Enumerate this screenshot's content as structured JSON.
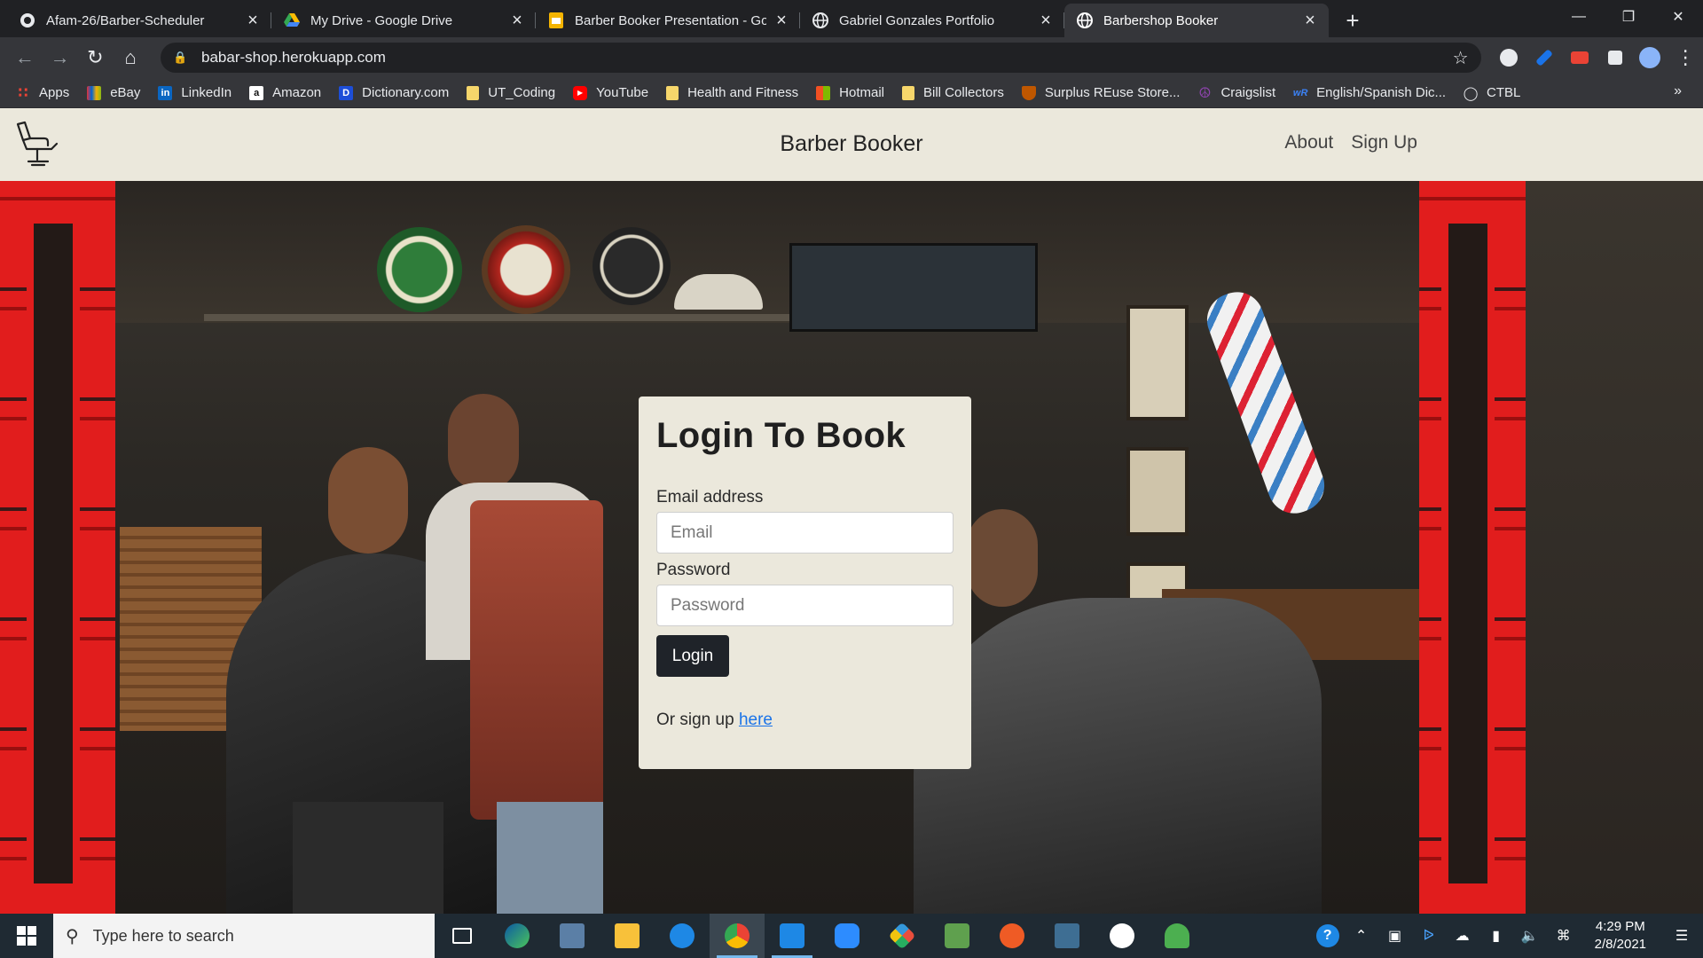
{
  "browser": {
    "tabs": [
      {
        "title": "Afam-26/Barber-Scheduler",
        "icon": "github-icon",
        "active": false
      },
      {
        "title": "My Drive - Google Drive",
        "icon": "google-drive-icon",
        "active": false
      },
      {
        "title": "Barber Booker Presentation - Goo",
        "icon": "google-slides-icon",
        "active": false
      },
      {
        "title": "Gabriel Gonzales Portfolio",
        "icon": "globe-icon",
        "active": false
      },
      {
        "title": "Barbershop Booker",
        "icon": "globe-icon",
        "active": true
      }
    ],
    "url": "babar-shop.herokuapp.com",
    "bookmarks": [
      {
        "label": "Apps",
        "icon": "apps-grid-icon",
        "color": "#ea4335"
      },
      {
        "label": "eBay",
        "icon": "ebay-icon",
        "color": "#0064d2"
      },
      {
        "label": "LinkedIn",
        "icon": "linkedin-icon",
        "color": "#0a66c2"
      },
      {
        "label": "Amazon",
        "icon": "amazon-icon",
        "color": "#ffffff"
      },
      {
        "label": "Dictionary.com",
        "icon": "dictionary-icon",
        "color": "#1d4ed8"
      },
      {
        "label": "UT_Coding",
        "icon": "folder-icon",
        "color": "#f6d66b"
      },
      {
        "label": "YouTube",
        "icon": "youtube-icon",
        "color": "#ff0000"
      },
      {
        "label": "Health and Fitness",
        "icon": "folder-icon",
        "color": "#f6d66b"
      },
      {
        "label": "Hotmail",
        "icon": "microsoft-icon",
        "color": "#00a4ef"
      },
      {
        "label": "Bill Collectors",
        "icon": "folder-icon",
        "color": "#f6d66b"
      },
      {
        "label": "Surplus REuse Store...",
        "icon": "shield-icon",
        "color": "#bf5700"
      },
      {
        "label": "Craigslist",
        "icon": "peace-icon",
        "color": "#8e44ad"
      },
      {
        "label": "English/Spanish Dic...",
        "icon": "wordreference-icon",
        "color": "#3b82f6"
      },
      {
        "label": "CTBL",
        "icon": "globe-icon",
        "color": "#e8eaed"
      }
    ]
  },
  "site": {
    "brand": "Barber Booker",
    "nav": {
      "about": "About",
      "signup": "Sign Up"
    }
  },
  "login": {
    "title": "Login To Book",
    "email_label": "Email address",
    "email_placeholder": "Email",
    "password_label": "Password",
    "password_placeholder": "Password",
    "button": "Login",
    "signup_prefix": "Or sign up ",
    "signup_link": "here"
  },
  "taskbar": {
    "search_placeholder": "Type here to search",
    "time": "4:29 PM",
    "date": "2/8/2021"
  },
  "colors": {
    "nav_bg": "#ebe8dc",
    "card_bg": "#ebe8dc",
    "button_bg": "#1f2329",
    "link": "#1a73e8",
    "barber_pole_red": "#e11d1d"
  }
}
